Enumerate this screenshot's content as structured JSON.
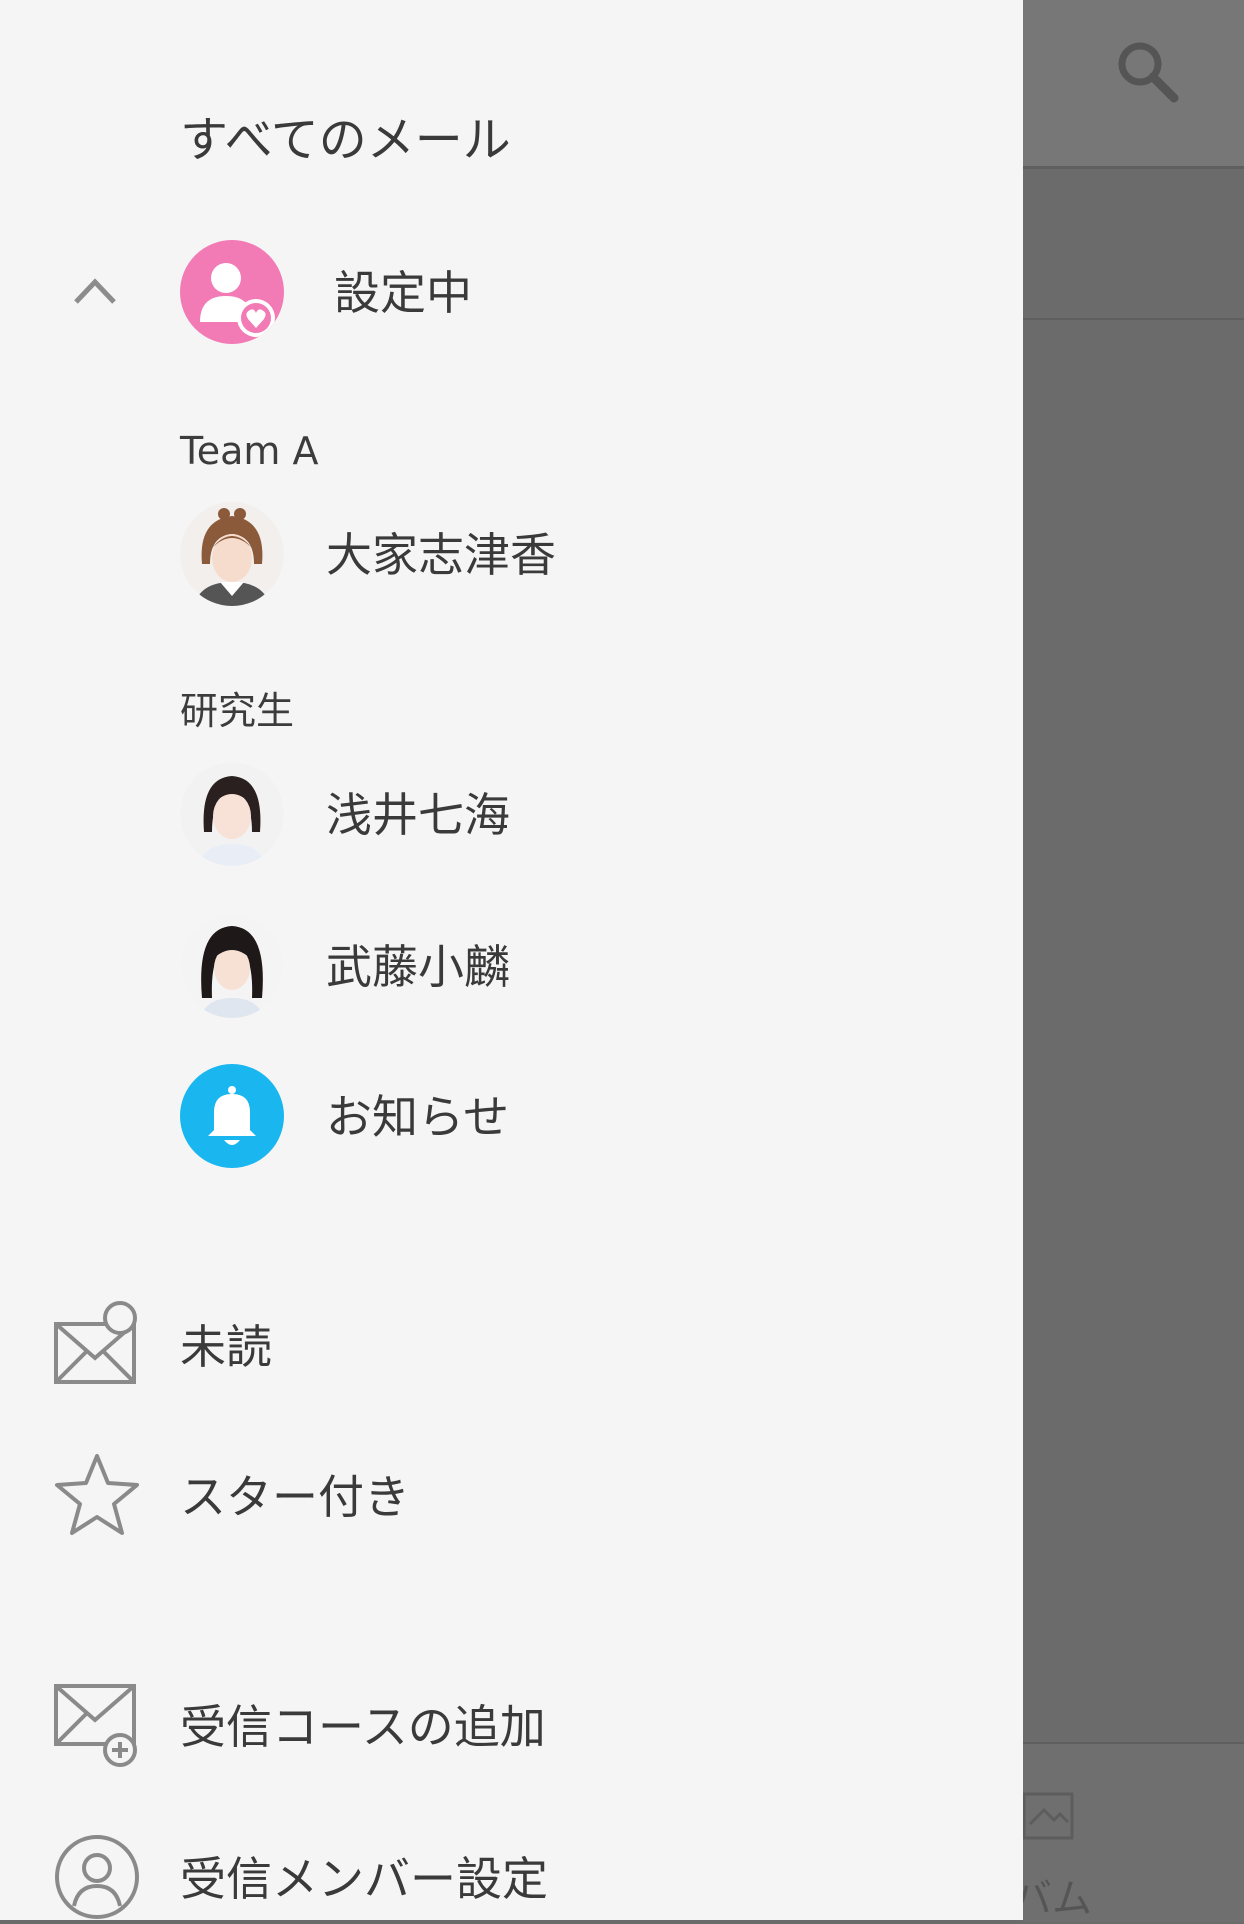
{
  "drawer": {
    "header_title": "すべてのメール",
    "profile": {
      "label": "設定中"
    },
    "groups": [
      {
        "title": "Team A",
        "members": [
          {
            "name": "大家志津香"
          }
        ]
      },
      {
        "title": "研究生",
        "members": [
          {
            "name": "浅井七海"
          },
          {
            "name": "武藤小麟"
          }
        ]
      }
    ],
    "notice": {
      "label": "お知らせ"
    },
    "menu": {
      "unread": "未読",
      "starred": "スター付き",
      "add_course": "受信コースの追加",
      "member_settings": "受信メンバー設定"
    }
  },
  "background": {
    "bottom_tab_partial": "バム"
  },
  "colors": {
    "drawer_bg": "#f5f5f5",
    "profile_pink": "#f27ab5",
    "notice_blue": "#19b6f0",
    "icon_gray": "#8a8a8a",
    "scrim": "#6b6b6b"
  }
}
